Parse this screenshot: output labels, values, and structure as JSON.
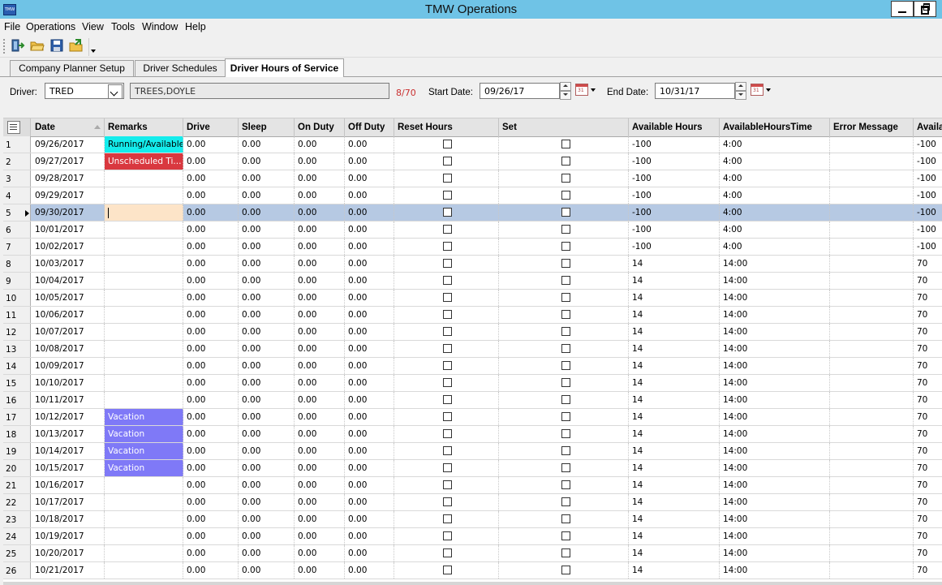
{
  "app": {
    "title": "TMW Operations",
    "icon_label": "TMW"
  },
  "menu": [
    "File",
    "Operations",
    "View",
    "Tools",
    "Window",
    "Help"
  ],
  "toolbar": {
    "icons": [
      "exit-icon",
      "open-folder-icon",
      "save-icon",
      "open-icon"
    ]
  },
  "tabs": [
    {
      "label": "Company Planner Setup",
      "active": false
    },
    {
      "label": "Driver Schedules",
      "active": false
    },
    {
      "label": "Driver Hours of Service",
      "active": true
    }
  ],
  "filters": {
    "driver_label": "Driver:",
    "driver_id": "TRED",
    "driver_name": "TREES,DOYLE",
    "hours_count": "8/70",
    "start_label": "Start Date:",
    "start_date": "09/26/17",
    "end_label": "End Date:",
    "end_date": "10/31/17"
  },
  "grid": {
    "columns": [
      "Date",
      "Remarks",
      "Drive",
      "Sleep",
      "On Duty",
      "Off Duty",
      "Reset Hours",
      "Set",
      "Available Hours",
      "AvailableHoursTime",
      "Error Message",
      "Availa"
    ],
    "selected_row": 5,
    "rows": [
      {
        "num": "1",
        "date": "09/26/2017",
        "remarks": "Running/Available",
        "remark_type": "running",
        "drive": "0.00",
        "sleep": "0.00",
        "on_duty": "0.00",
        "off_duty": "0.00",
        "avail_hours": "-100",
        "avail_time": "4:00",
        "error": "",
        "avail2": "-100"
      },
      {
        "num": "2",
        "date": "09/27/2017",
        "remarks": "Unscheduled Ti...",
        "remark_type": "unscheduled",
        "drive": "0.00",
        "sleep": "0.00",
        "on_duty": "0.00",
        "off_duty": "0.00",
        "avail_hours": "-100",
        "avail_time": "4:00",
        "error": "",
        "avail2": "-100"
      },
      {
        "num": "3",
        "date": "09/28/2017",
        "remarks": "",
        "remark_type": "",
        "drive": "0.00",
        "sleep": "0.00",
        "on_duty": "0.00",
        "off_duty": "0.00",
        "avail_hours": "-100",
        "avail_time": "4:00",
        "error": "",
        "avail2": "-100"
      },
      {
        "num": "4",
        "date": "09/29/2017",
        "remarks": "",
        "remark_type": "",
        "drive": "0.00",
        "sleep": "0.00",
        "on_duty": "0.00",
        "off_duty": "0.00",
        "avail_hours": "-100",
        "avail_time": "4:00",
        "error": "",
        "avail2": "-100"
      },
      {
        "num": "5",
        "date": "09/30/2017",
        "remarks": "",
        "remark_type": "editing",
        "drive": "0.00",
        "sleep": "0.00",
        "on_duty": "0.00",
        "off_duty": "0.00",
        "avail_hours": "-100",
        "avail_time": "4:00",
        "error": "",
        "avail2": "-100"
      },
      {
        "num": "6",
        "date": "10/01/2017",
        "remarks": "",
        "remark_type": "",
        "drive": "0.00",
        "sleep": "0.00",
        "on_duty": "0.00",
        "off_duty": "0.00",
        "avail_hours": "-100",
        "avail_time": "4:00",
        "error": "",
        "avail2": "-100"
      },
      {
        "num": "7",
        "date": "10/02/2017",
        "remarks": "",
        "remark_type": "",
        "drive": "0.00",
        "sleep": "0.00",
        "on_duty": "0.00",
        "off_duty": "0.00",
        "avail_hours": "-100",
        "avail_time": "4:00",
        "error": "",
        "avail2": "-100"
      },
      {
        "num": "8",
        "date": "10/03/2017",
        "remarks": "",
        "remark_type": "",
        "drive": "0.00",
        "sleep": "0.00",
        "on_duty": "0.00",
        "off_duty": "0.00",
        "avail_hours": "14",
        "avail_time": "14:00",
        "error": "",
        "avail2": "70"
      },
      {
        "num": "9",
        "date": "10/04/2017",
        "remarks": "",
        "remark_type": "",
        "drive": "0.00",
        "sleep": "0.00",
        "on_duty": "0.00",
        "off_duty": "0.00",
        "avail_hours": "14",
        "avail_time": "14:00",
        "error": "",
        "avail2": "70"
      },
      {
        "num": "10",
        "date": "10/05/2017",
        "remarks": "",
        "remark_type": "",
        "drive": "0.00",
        "sleep": "0.00",
        "on_duty": "0.00",
        "off_duty": "0.00",
        "avail_hours": "14",
        "avail_time": "14:00",
        "error": "",
        "avail2": "70"
      },
      {
        "num": "11",
        "date": "10/06/2017",
        "remarks": "",
        "remark_type": "",
        "drive": "0.00",
        "sleep": "0.00",
        "on_duty": "0.00",
        "off_duty": "0.00",
        "avail_hours": "14",
        "avail_time": "14:00",
        "error": "",
        "avail2": "70"
      },
      {
        "num": "12",
        "date": "10/07/2017",
        "remarks": "",
        "remark_type": "",
        "drive": "0.00",
        "sleep": "0.00",
        "on_duty": "0.00",
        "off_duty": "0.00",
        "avail_hours": "14",
        "avail_time": "14:00",
        "error": "",
        "avail2": "70"
      },
      {
        "num": "13",
        "date": "10/08/2017",
        "remarks": "",
        "remark_type": "",
        "drive": "0.00",
        "sleep": "0.00",
        "on_duty": "0.00",
        "off_duty": "0.00",
        "avail_hours": "14",
        "avail_time": "14:00",
        "error": "",
        "avail2": "70"
      },
      {
        "num": "14",
        "date": "10/09/2017",
        "remarks": "",
        "remark_type": "",
        "drive": "0.00",
        "sleep": "0.00",
        "on_duty": "0.00",
        "off_duty": "0.00",
        "avail_hours": "14",
        "avail_time": "14:00",
        "error": "",
        "avail2": "70"
      },
      {
        "num": "15",
        "date": "10/10/2017",
        "remarks": "",
        "remark_type": "",
        "drive": "0.00",
        "sleep": "0.00",
        "on_duty": "0.00",
        "off_duty": "0.00",
        "avail_hours": "14",
        "avail_time": "14:00",
        "error": "",
        "avail2": "70"
      },
      {
        "num": "16",
        "date": "10/11/2017",
        "remarks": "",
        "remark_type": "",
        "drive": "0.00",
        "sleep": "0.00",
        "on_duty": "0.00",
        "off_duty": "0.00",
        "avail_hours": "14",
        "avail_time": "14:00",
        "error": "",
        "avail2": "70"
      },
      {
        "num": "17",
        "date": "10/12/2017",
        "remarks": "Vacation",
        "remark_type": "vacation",
        "drive": "0.00",
        "sleep": "0.00",
        "on_duty": "0.00",
        "off_duty": "0.00",
        "avail_hours": "14",
        "avail_time": "14:00",
        "error": "",
        "avail2": "70"
      },
      {
        "num": "18",
        "date": "10/13/2017",
        "remarks": "Vacation",
        "remark_type": "vacation",
        "drive": "0.00",
        "sleep": "0.00",
        "on_duty": "0.00",
        "off_duty": "0.00",
        "avail_hours": "14",
        "avail_time": "14:00",
        "error": "",
        "avail2": "70"
      },
      {
        "num": "19",
        "date": "10/14/2017",
        "remarks": "Vacation",
        "remark_type": "vacation",
        "drive": "0.00",
        "sleep": "0.00",
        "on_duty": "0.00",
        "off_duty": "0.00",
        "avail_hours": "14",
        "avail_time": "14:00",
        "error": "",
        "avail2": "70"
      },
      {
        "num": "20",
        "date": "10/15/2017",
        "remarks": "Vacation",
        "remark_type": "vacation",
        "drive": "0.00",
        "sleep": "0.00",
        "on_duty": "0.00",
        "off_duty": "0.00",
        "avail_hours": "14",
        "avail_time": "14:00",
        "error": "",
        "avail2": "70"
      },
      {
        "num": "21",
        "date": "10/16/2017",
        "remarks": "",
        "remark_type": "",
        "drive": "0.00",
        "sleep": "0.00",
        "on_duty": "0.00",
        "off_duty": "0.00",
        "avail_hours": "14",
        "avail_time": "14:00",
        "error": "",
        "avail2": "70"
      },
      {
        "num": "22",
        "date": "10/17/2017",
        "remarks": "",
        "remark_type": "",
        "drive": "0.00",
        "sleep": "0.00",
        "on_duty": "0.00",
        "off_duty": "0.00",
        "avail_hours": "14",
        "avail_time": "14:00",
        "error": "",
        "avail2": "70"
      },
      {
        "num": "23",
        "date": "10/18/2017",
        "remarks": "",
        "remark_type": "",
        "drive": "0.00",
        "sleep": "0.00",
        "on_duty": "0.00",
        "off_duty": "0.00",
        "avail_hours": "14",
        "avail_time": "14:00",
        "error": "",
        "avail2": "70"
      },
      {
        "num": "24",
        "date": "10/19/2017",
        "remarks": "",
        "remark_type": "",
        "drive": "0.00",
        "sleep": "0.00",
        "on_duty": "0.00",
        "off_duty": "0.00",
        "avail_hours": "14",
        "avail_time": "14:00",
        "error": "",
        "avail2": "70"
      },
      {
        "num": "25",
        "date": "10/20/2017",
        "remarks": "",
        "remark_type": "",
        "drive": "0.00",
        "sleep": "0.00",
        "on_duty": "0.00",
        "off_duty": "0.00",
        "avail_hours": "14",
        "avail_time": "14:00",
        "error": "",
        "avail2": "70"
      },
      {
        "num": "26",
        "date": "10/21/2017",
        "remarks": "",
        "remark_type": "",
        "drive": "0.00",
        "sleep": "0.00",
        "on_duty": "0.00",
        "off_duty": "0.00",
        "avail_hours": "14",
        "avail_time": "14:00",
        "error": "",
        "avail2": "70"
      }
    ]
  },
  "colors": {
    "titlebar": "#6fc3e6",
    "running": "#14ecec",
    "unscheduled": "#d9383f",
    "vacation": "#7f79f7",
    "selected_row": "#b6c9e3",
    "count_text": "#c92e2e"
  }
}
